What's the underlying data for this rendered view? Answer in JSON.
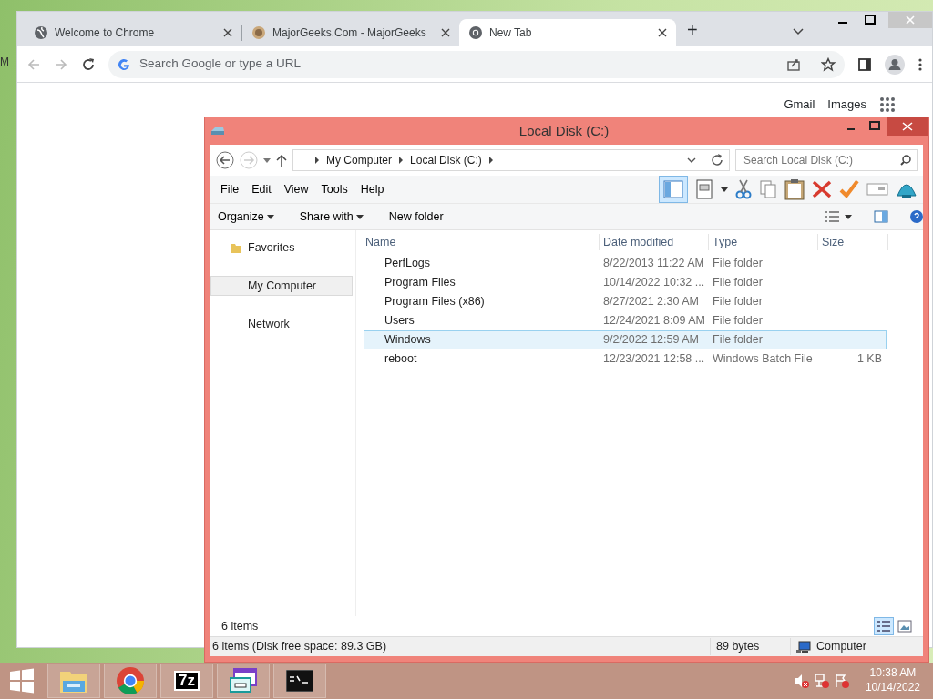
{
  "desktop": {
    "edge_text": "M"
  },
  "chrome": {
    "tabs": [
      {
        "title": "Welcome to Chrome",
        "kind": "globe",
        "selected": false
      },
      {
        "title": "MajorGeeks.Com - MajorGeeks",
        "kind": "site",
        "selected": false
      },
      {
        "title": "New Tab",
        "kind": "chrome",
        "selected": true
      }
    ],
    "new_tab": "+",
    "omnibox": {
      "placeholder": "Search Google or type a URL"
    },
    "links": [
      "Gmail",
      "Images"
    ]
  },
  "explorer": {
    "title": "Local Disk (C:)",
    "breadcrumb": [
      "My Computer",
      "Local Disk (C:)"
    ],
    "search": {
      "placeholder": "Search Local Disk (C:)"
    },
    "menu": [
      "File",
      "Edit",
      "View",
      "Tools",
      "Help"
    ],
    "preview_pane_on": true,
    "commands": [
      {
        "label": "Organize",
        "dropdown": true
      },
      {
        "label": "Share with",
        "dropdown": true
      },
      {
        "label": "New folder",
        "dropdown": false
      }
    ],
    "nav": [
      {
        "label": "Favorites",
        "kind": "folder",
        "selected": false
      },
      {
        "label": "My Computer",
        "kind": "plain",
        "selected": true
      },
      {
        "label": "Network",
        "kind": "plain",
        "selected": false
      }
    ],
    "columns": [
      "Name",
      "Date modified",
      "Type",
      "Size"
    ],
    "rows": [
      {
        "name": "PerfLogs",
        "date": "8/22/2013 11:22 AM",
        "type": "File folder",
        "selected": false
      },
      {
        "name": "Program Files",
        "date": "10/14/2022 10:32 ...",
        "type": "File folder",
        "selected": false
      },
      {
        "name": "Program Files (x86)",
        "date": "8/27/2021 2:30 AM",
        "type": "File folder",
        "selected": false
      },
      {
        "name": "Users",
        "date": "12/24/2021 8:09 AM",
        "type": "File folder",
        "selected": false
      },
      {
        "name": "Windows",
        "date": "9/2/2022 12:59 AM",
        "type": "File folder",
        "selected": true
      },
      {
        "name": "reboot",
        "date": "12/23/2021 12:58 ...",
        "type": "Windows Batch File",
        "size": "1 KB",
        "selected": false
      }
    ],
    "item_count": "6 items",
    "status_bar": [
      "6 items (Disk free space: 89.3 GB)",
      "89 bytes",
      "Computer"
    ]
  },
  "taskbar": {
    "apps": [
      {
        "kind": "explorer"
      },
      {
        "kind": "chrome"
      },
      {
        "kind": "sevenzip",
        "label": "7z"
      },
      {
        "kind": "remote"
      },
      {
        "kind": "cmd"
      }
    ],
    "clock": {
      "time": "10:38 AM",
      "date": "10/14/2022"
    }
  }
}
